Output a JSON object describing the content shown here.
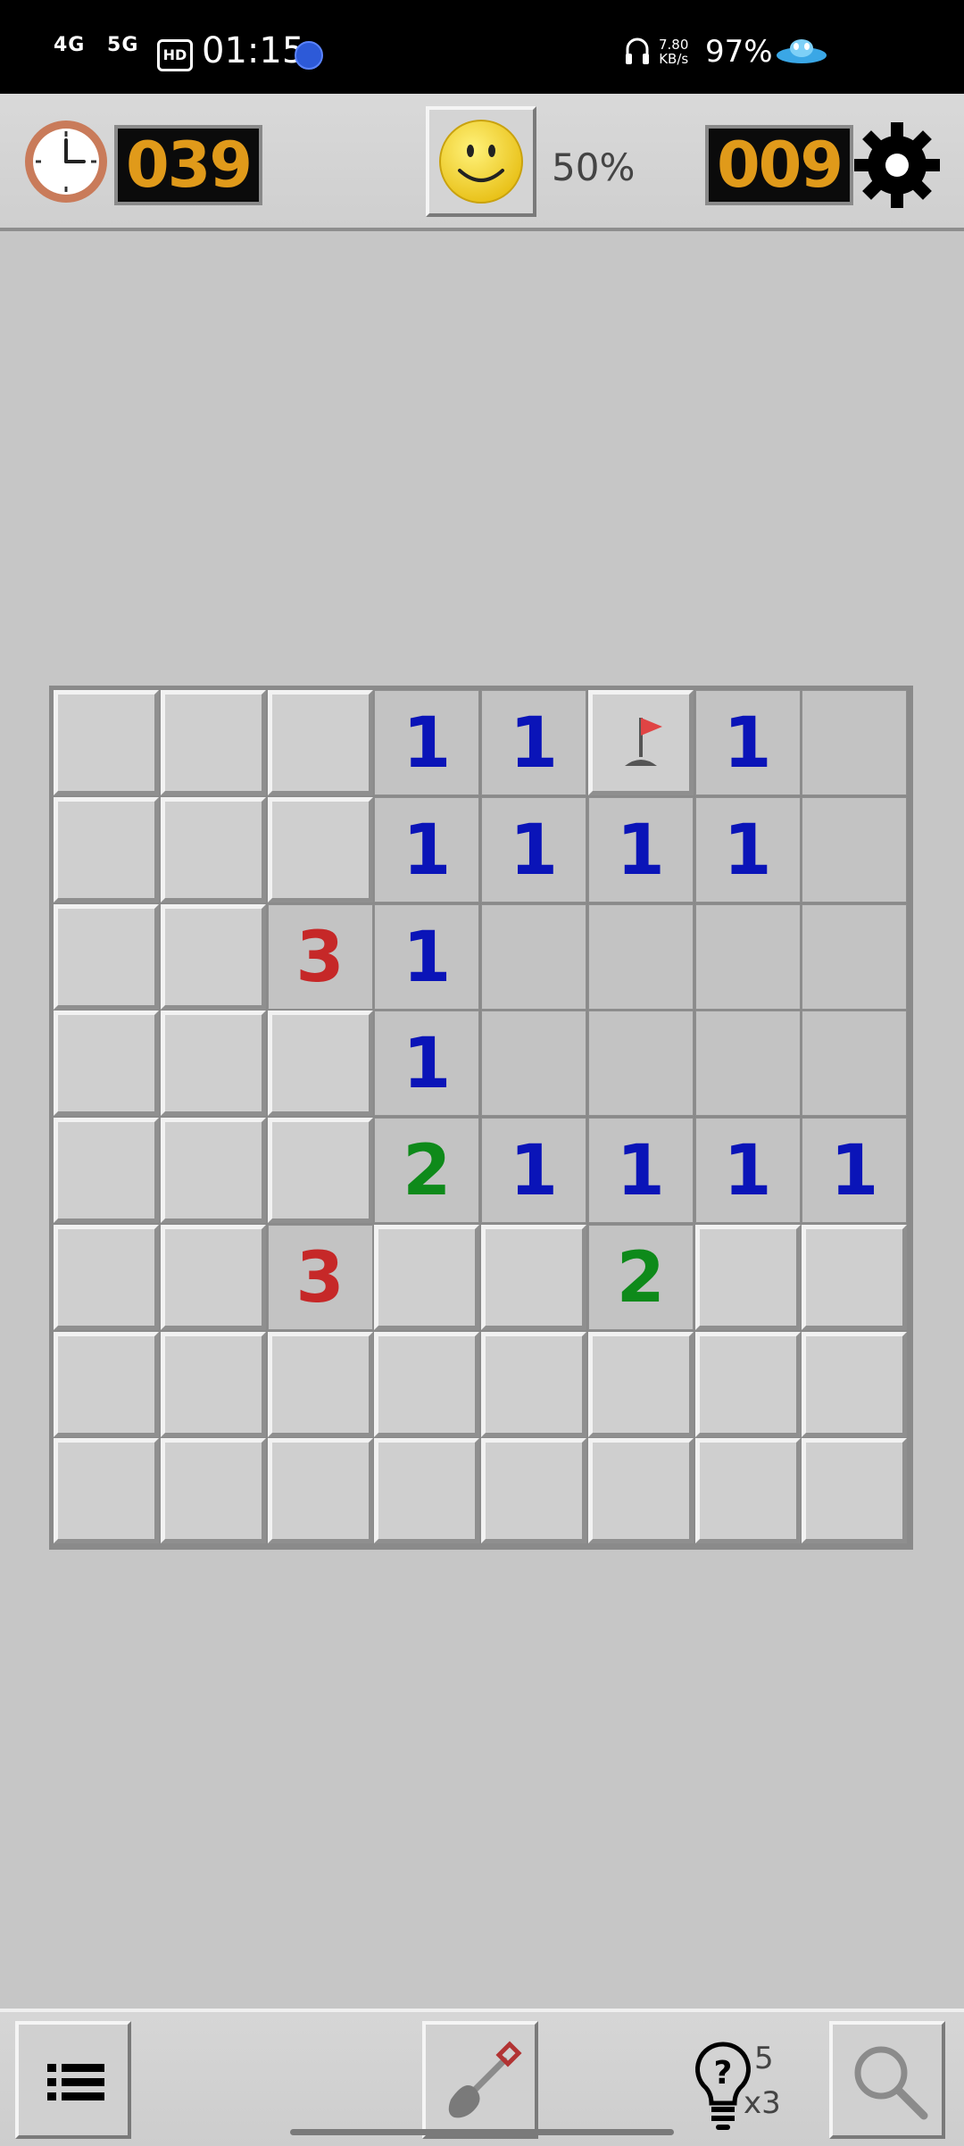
{
  "status_bar": {
    "net1": "4G",
    "net2": "5G",
    "hd": "HD",
    "time": "01:15",
    "speed": "7.80",
    "speed_unit": "KB/s",
    "battery": "97%"
  },
  "top_bar": {
    "timer": "039",
    "percent": "50%",
    "mines_left": "009"
  },
  "board": {
    "rows": 8,
    "cols": 8,
    "cells": [
      [
        "c",
        "c",
        "c",
        "1",
        "1",
        "F",
        "1",
        "0"
      ],
      [
        "c",
        "c",
        "c",
        "1",
        "1",
        "1",
        "1",
        "0"
      ],
      [
        "c",
        "c",
        "3",
        "1",
        "0",
        "0",
        "0",
        "0"
      ],
      [
        "c",
        "c",
        "c",
        "1",
        "0",
        "0",
        "0",
        "0"
      ],
      [
        "c",
        "c",
        "c",
        "2",
        "1",
        "1",
        "1",
        "1"
      ],
      [
        "c",
        "c",
        "3",
        "c",
        "c",
        "2",
        "c",
        "c"
      ],
      [
        "c",
        "c",
        "c",
        "c",
        "c",
        "c",
        "c",
        "c"
      ],
      [
        "c",
        "c",
        "c",
        "c",
        "c",
        "c",
        "c",
        "c"
      ]
    ]
  },
  "bottom_bar": {
    "hint_count": "5",
    "hint_multiplier": "x3"
  },
  "icons": {
    "timer": "clock-icon",
    "status": "smiley-icon",
    "settings": "gear-icon",
    "menu": "list-icon",
    "dig": "shovel-icon",
    "hint": "lightbulb-question-icon",
    "search": "magnifier-icon",
    "flag": "flag-icon"
  },
  "colors": {
    "lcd_digits": "#e09a1a",
    "number_1": "#0a14b8",
    "number_2": "#0e8a1a",
    "number_3": "#c62828"
  }
}
